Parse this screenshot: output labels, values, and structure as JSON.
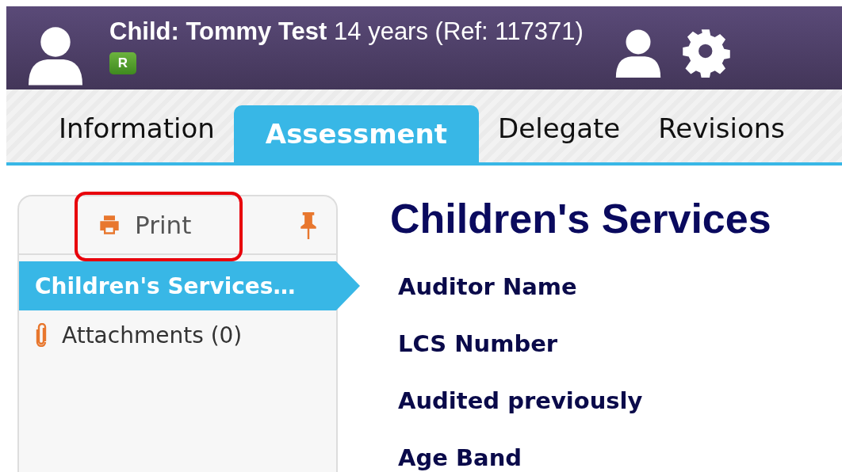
{
  "header": {
    "child_label": "Child: Tommy Test",
    "details": "14 years (Ref: 117371)",
    "badge": "R"
  },
  "tabs": [
    {
      "label": "Information",
      "selected": false
    },
    {
      "label": "Assessment",
      "selected": true
    },
    {
      "label": "Delegate",
      "selected": false
    },
    {
      "label": "Revisions",
      "selected": false
    }
  ],
  "sidebar": {
    "print_button": {
      "label": "Print",
      "highlighted": true
    },
    "items": [
      {
        "kind": "section",
        "label": "Children's Services…",
        "selected": true
      },
      {
        "kind": "attachment",
        "label": "Attachments (0)",
        "selected": false
      }
    ]
  },
  "content": {
    "title": "Children's Services",
    "fields": [
      "Auditor Name",
      "LCS Number",
      "Audited previously",
      "Age Band"
    ]
  }
}
